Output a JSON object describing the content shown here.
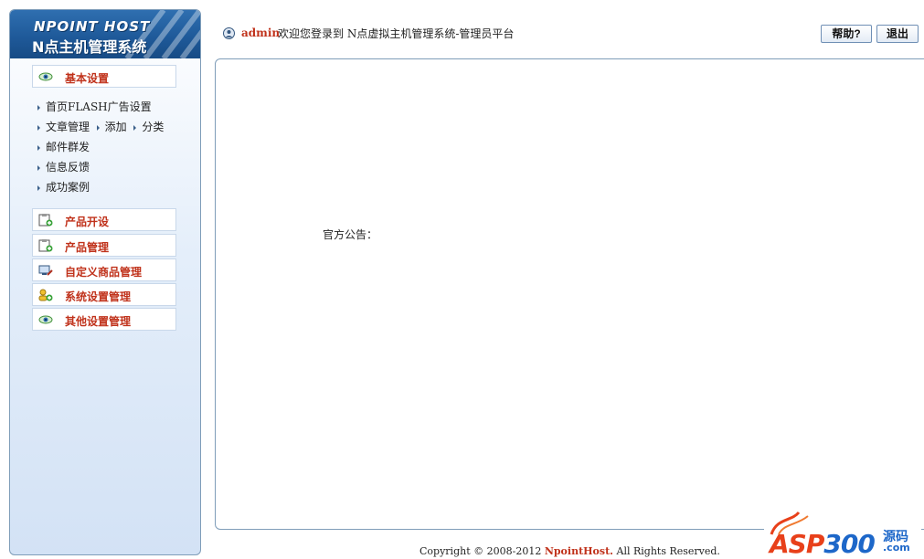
{
  "logo": {
    "title": "NPOINT HOST",
    "subtitle": "N点主机管理系统"
  },
  "sidebar": {
    "basic_settings": {
      "label": "基本设置",
      "icon": "eye-icon"
    },
    "subitems": [
      {
        "label": "首页FLASH广告设置"
      },
      {
        "label": "文章管理",
        "extras": [
          {
            "label": "添加"
          },
          {
            "label": "分类"
          }
        ]
      },
      {
        "label": "邮件群发"
      },
      {
        "label": "信息反馈"
      },
      {
        "label": "成功案例"
      }
    ],
    "sections": [
      {
        "label": "产品开设",
        "icon": "clipboard-add-icon"
      },
      {
        "label": "产品管理",
        "icon": "clipboard-add-icon"
      },
      {
        "label": "自定义商品管理",
        "icon": "monitor-tools-icon"
      },
      {
        "label": "系统设置管理",
        "icon": "users-settings-icon"
      },
      {
        "label": "其他设置管理",
        "icon": "eye-icon"
      }
    ]
  },
  "header": {
    "username": "admin",
    "welcome_text": "欢迎您登录到 N点虚拟主机管理系统-管理员平台",
    "help_label": "帮助?",
    "logout_label": "退出"
  },
  "main": {
    "notice_label": "官方公告："
  },
  "footer": {
    "copyright_prefix": "Copyright © 2008-2012 ",
    "brand": "NpointHost.",
    "rights": " All Rights Reserved."
  },
  "watermark": {
    "asp": "ASP",
    "number": "300",
    "cn": "源码",
    "com": ".com"
  },
  "colors": {
    "accent_red": "#c0321b",
    "border_blue": "#7f9db9",
    "logo_blue": "#1f5a9a"
  }
}
